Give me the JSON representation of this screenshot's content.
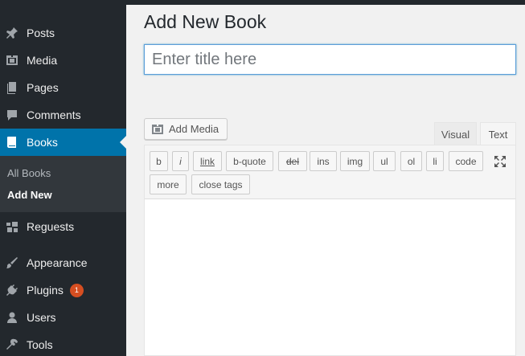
{
  "sidebar": {
    "items": [
      {
        "label": "Posts",
        "icon": "pin-icon"
      },
      {
        "label": "Media",
        "icon": "media-icon"
      },
      {
        "label": "Pages",
        "icon": "pages-icon"
      },
      {
        "label": "Comments",
        "icon": "comment-icon"
      },
      {
        "label": "Books",
        "icon": "book-icon",
        "active": true
      },
      {
        "label": "Reguests",
        "icon": "requests-icon"
      },
      {
        "label": "Appearance",
        "icon": "brush-icon"
      },
      {
        "label": "Plugins",
        "icon": "plug-icon",
        "badge": "1"
      },
      {
        "label": "Users",
        "icon": "user-icon"
      },
      {
        "label": "Tools",
        "icon": "wrench-icon"
      }
    ],
    "submenu": {
      "all": "All Books",
      "add_new": "Add New"
    },
    "active_color": "#0073aa",
    "badge_color": "#d54e21"
  },
  "main": {
    "title": "Add New Book",
    "title_placeholder": "Enter title here",
    "title_value": "",
    "add_media_label": "Add Media",
    "tabs": {
      "visual": "Visual",
      "text": "Text"
    },
    "quicktags": [
      "b",
      "i",
      "link",
      "b-quote",
      "del",
      "ins",
      "img",
      "ul",
      "ol",
      "li",
      "code",
      "more",
      "close tags"
    ],
    "content_value": ""
  }
}
